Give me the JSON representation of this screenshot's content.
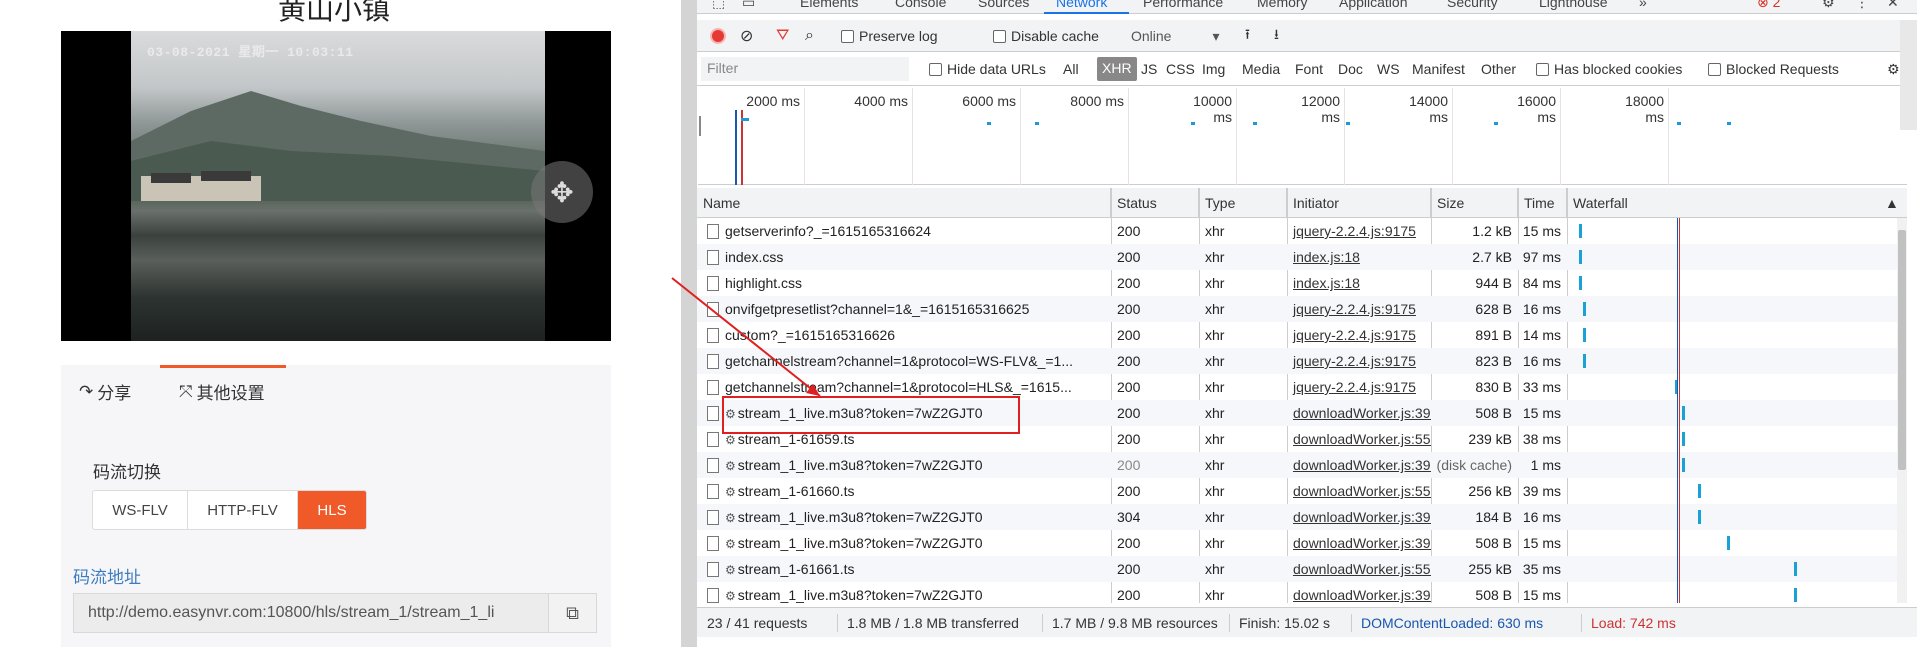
{
  "left": {
    "page_title": "黄山小镇",
    "video": {
      "osd_timestamp": "03-08-2021 星期一 10:03:11"
    },
    "tabs": [
      {
        "label": "分享",
        "icon": "share-icon"
      },
      {
        "label": "其他设置",
        "icon": "expand-icon"
      }
    ],
    "stream_switch_label": "码流切换",
    "stream_options": [
      "WS-FLV",
      "HTTP-FLV",
      "HLS"
    ],
    "stream_selected": "HLS",
    "url_label": "码流地址",
    "url_value": "http://demo.easynvr.com:10800/hls/stream_1/stream_1_li"
  },
  "devtools": {
    "tabs": [
      "Elements",
      "Console",
      "Sources",
      "Network",
      "Performance",
      "Memory",
      "Application",
      "Security",
      "Lighthouse"
    ],
    "active_tab": "Network",
    "error_count": "2",
    "toolbar": {
      "preserve_log": "Preserve log",
      "disable_cache": "Disable cache",
      "throttle": "Online"
    },
    "filter": {
      "placeholder": "Filter",
      "hide_data_urls": "Hide data URLs",
      "types": [
        "All",
        "XHR",
        "JS",
        "CSS",
        "Img",
        "Media",
        "Font",
        "Doc",
        "WS",
        "Manifest",
        "Other"
      ],
      "active_type": "XHR",
      "has_blocked_cookies": "Has blocked cookies",
      "blocked_requests": "Blocked Requests"
    },
    "overview_ticks": [
      "2000 ms",
      "4000 ms",
      "6000 ms",
      "8000 ms",
      "10000 ms",
      "12000 ms",
      "14000 ms",
      "16000 ms",
      "18000 ms"
    ],
    "columns": [
      "Name",
      "Status",
      "Type",
      "Initiator",
      "Size",
      "Time",
      "Waterfall"
    ],
    "rows": [
      {
        "name": "getserverinfo?_=1615165316624",
        "status": "200",
        "type": "xhr",
        "initiator": "jquery-2.2.4.js:9175",
        "size": "1.2 kB",
        "time": "15 ms",
        "gear": false,
        "wf": 0.02
      },
      {
        "name": "index.css",
        "status": "200",
        "type": "xhr",
        "initiator": "index.js:18",
        "size": "2.7 kB",
        "time": "97 ms",
        "gear": false,
        "wf": 0.02
      },
      {
        "name": "highlight.css",
        "status": "200",
        "type": "xhr",
        "initiator": "index.js:18",
        "size": "944 B",
        "time": "84 ms",
        "gear": false,
        "wf": 0.02
      },
      {
        "name": "onvifgetpresetlist?channel=1&_=1615165316625",
        "status": "200",
        "type": "xhr",
        "initiator": "jquery-2.2.4.js:9175",
        "size": "628 B",
        "time": "16 ms",
        "gear": false,
        "wf": 0.03
      },
      {
        "name": "custom?_=1615165316626",
        "status": "200",
        "type": "xhr",
        "initiator": "jquery-2.2.4.js:9175",
        "size": "891 B",
        "time": "14 ms",
        "gear": false,
        "wf": 0.03
      },
      {
        "name": "getchannelstream?channel=1&protocol=WS-FLV&_=1...",
        "status": "200",
        "type": "xhr",
        "initiator": "jquery-2.2.4.js:9175",
        "size": "823 B",
        "time": "16 ms",
        "gear": false,
        "wf": 0.03
      },
      {
        "name": "getchannelstream?channel=1&protocol=HLS&_=1615...",
        "status": "200",
        "type": "xhr",
        "initiator": "jquery-2.2.4.js:9175",
        "size": "830 B",
        "time": "33 ms",
        "gear": false,
        "wf": 0.32
      },
      {
        "name": "stream_1_live.m3u8?token=7wZ2GJT0",
        "status": "200",
        "type": "xhr",
        "initiator": "downloadWorker.js:395",
        "size": "508 B",
        "time": "15 ms",
        "gear": true,
        "wf": 0.34
      },
      {
        "name": "stream_1-61659.ts",
        "status": "200",
        "type": "xhr",
        "initiator": "downloadWorker.js:558",
        "size": "239 kB",
        "time": "38 ms",
        "gear": true,
        "wf": 0.34
      },
      {
        "name": "stream_1_live.m3u8?token=7wZ2GJT0",
        "status": "200",
        "type": "xhr",
        "initiator": "downloadWorker.js:395",
        "size": "(disk cache)",
        "time": "1 ms",
        "gear": true,
        "wf": 0.34
      },
      {
        "name": "stream_1-61660.ts",
        "status": "200",
        "type": "xhr",
        "initiator": "downloadWorker.js:558",
        "size": "256 kB",
        "time": "39 ms",
        "gear": true,
        "wf": 0.39
      },
      {
        "name": "stream_1_live.m3u8?token=7wZ2GJT0",
        "status": "304",
        "type": "xhr",
        "initiator": "downloadWorker.js:395",
        "size": "184 B",
        "time": "16 ms",
        "gear": true,
        "wf": 0.39
      },
      {
        "name": "stream_1_live.m3u8?token=7wZ2GJT0",
        "status": "200",
        "type": "xhr",
        "initiator": "downloadWorker.js:395",
        "size": "508 B",
        "time": "15 ms",
        "gear": true,
        "wf": 0.48
      },
      {
        "name": "stream_1-61661.ts",
        "status": "200",
        "type": "xhr",
        "initiator": "downloadWorker.js:558",
        "size": "255 kB",
        "time": "35 ms",
        "gear": true,
        "wf": 0.69
      },
      {
        "name": "stream_1_live.m3u8?token=7wZ2GJT0",
        "status": "200",
        "type": "xhr",
        "initiator": "downloadWorker.js:395",
        "size": "508 B",
        "time": "15 ms",
        "gear": true,
        "wf": 0.69
      }
    ],
    "status_bar": {
      "requests": "23 / 41 requests",
      "transferred": "1.8 MB / 1.8 MB transferred",
      "resources": "1.7 MB / 9.8 MB resources",
      "finish": "Finish: 15.02 s",
      "dom_loaded": "DOMContentLoaded: 630 ms",
      "load": "Load: 742 ms"
    },
    "colors": {
      "accent": "#1a73e8",
      "dom_loaded": "#1a56b0",
      "load": "#c33",
      "highlight": "#e02020",
      "hls_active": "#f05a28"
    }
  }
}
